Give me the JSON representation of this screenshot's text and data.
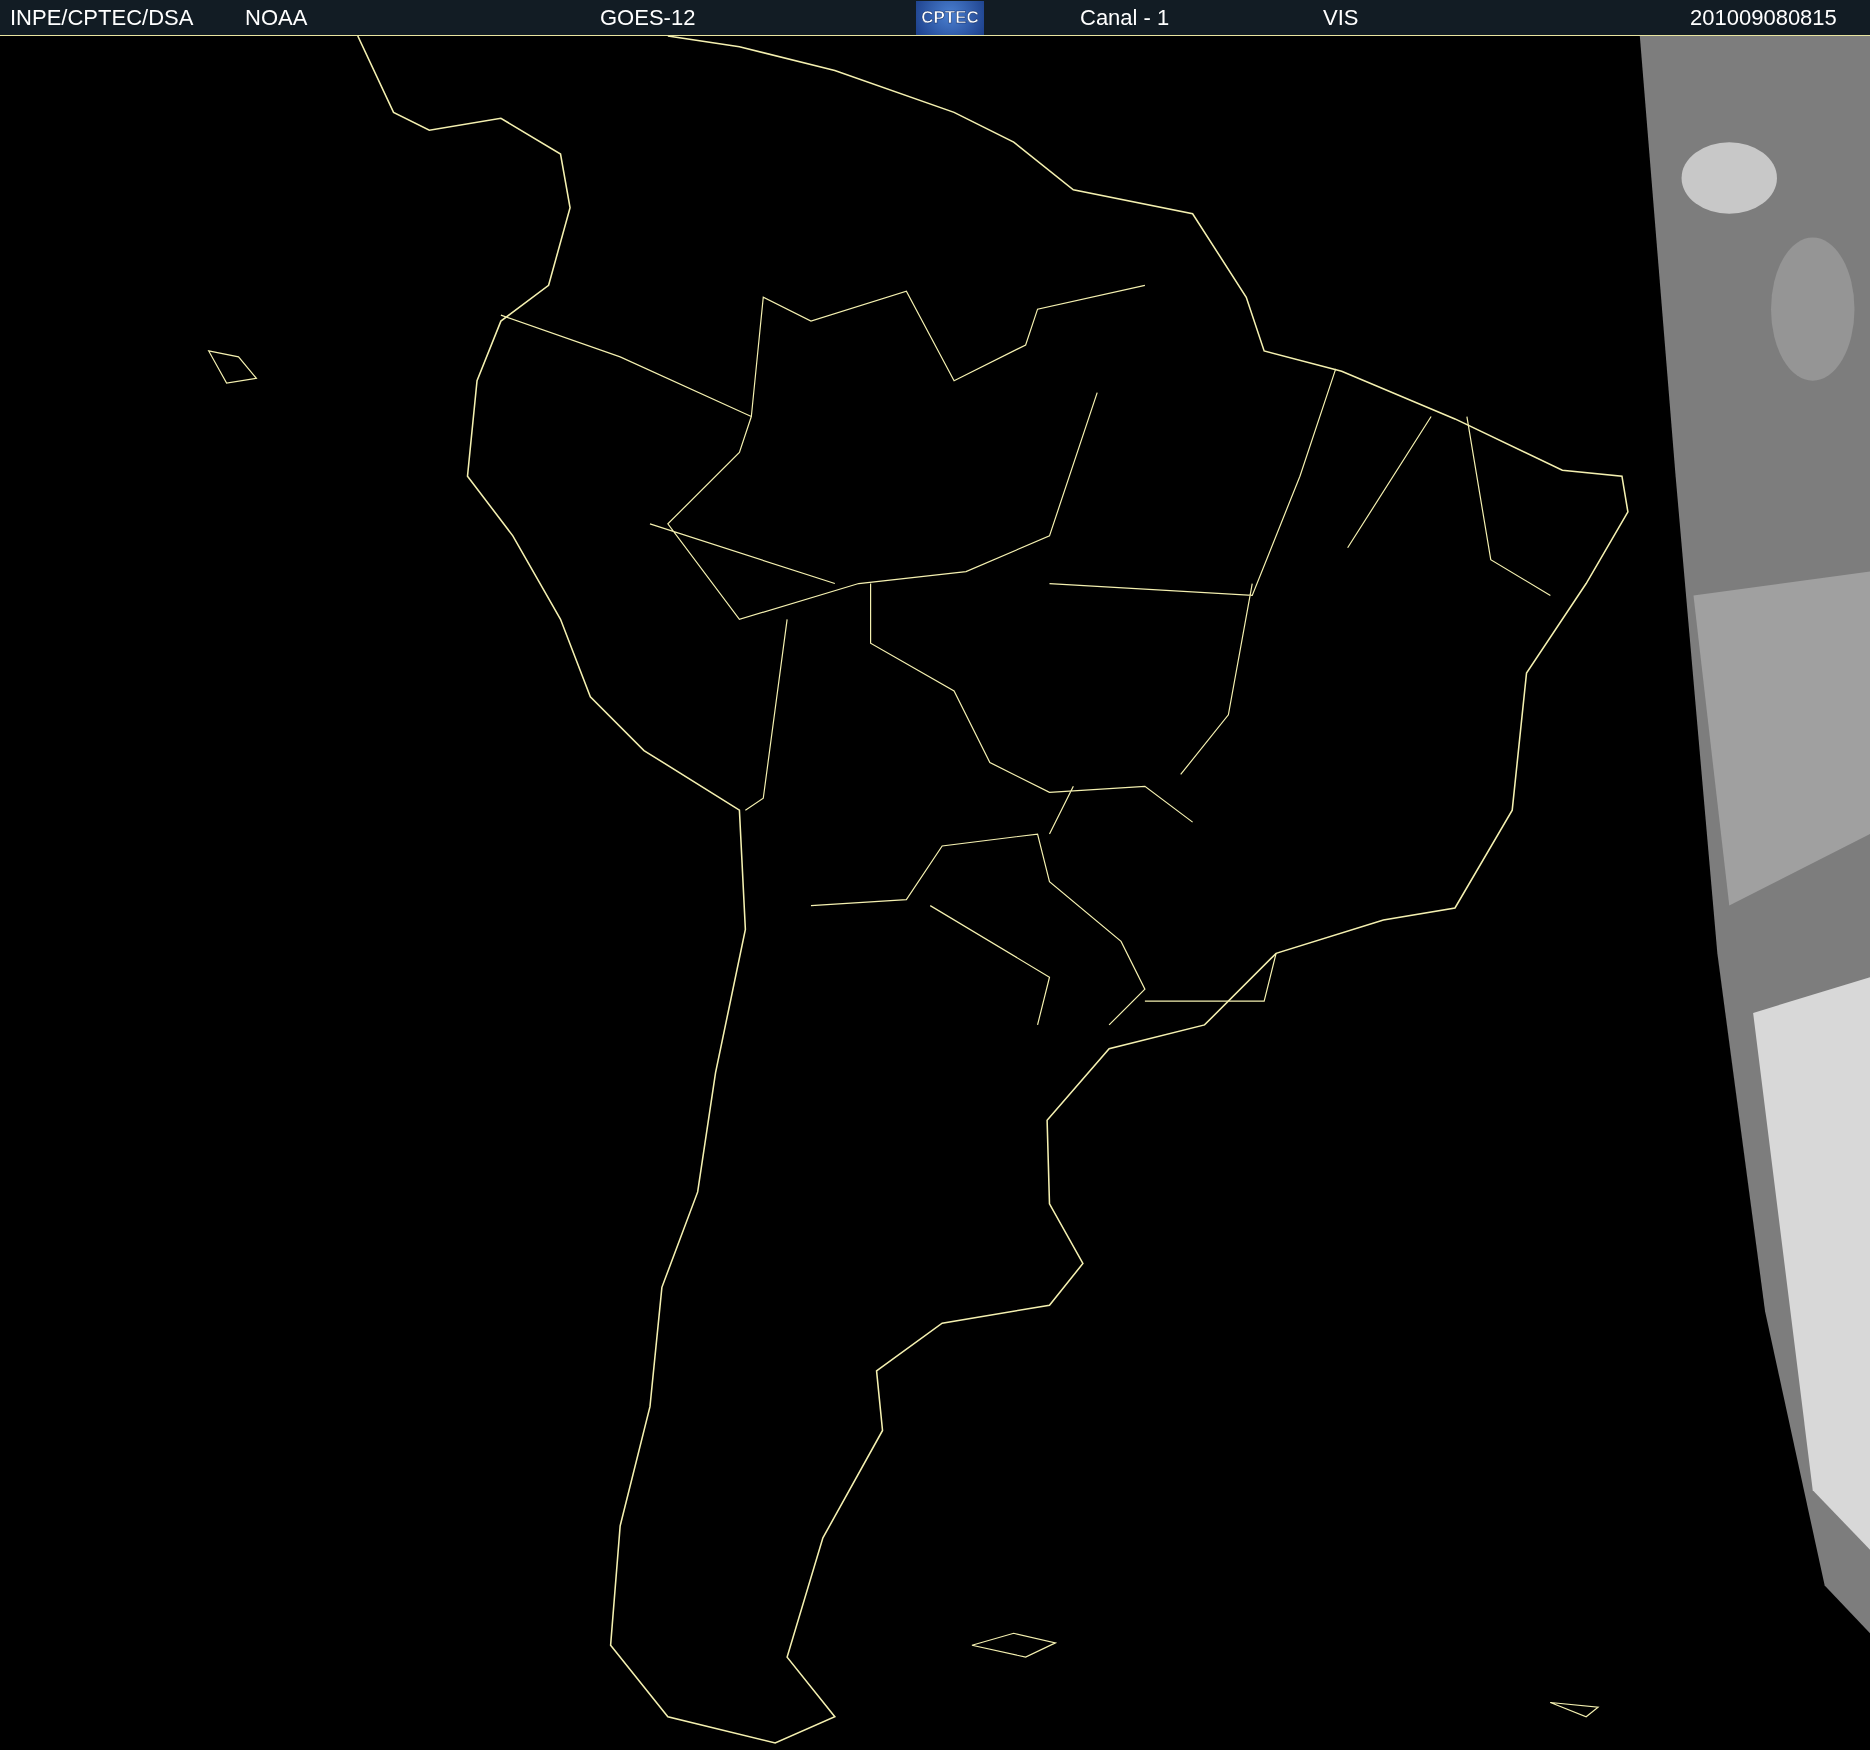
{
  "header": {
    "items": [
      "INPE/CPTEC/DSA",
      "NOAA",
      "GOES-12"
    ],
    "logo_text": "CPTEC",
    "items_after": [
      "Canal - 1",
      "VIS",
      "201009080815"
    ]
  }
}
